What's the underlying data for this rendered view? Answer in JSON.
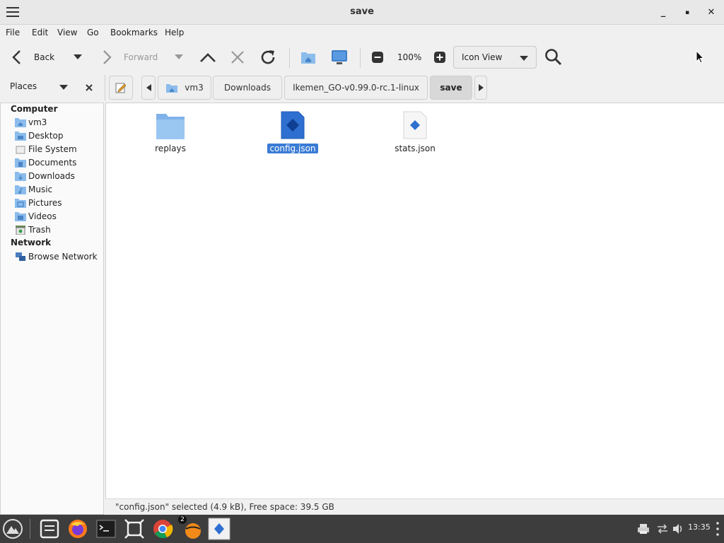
{
  "window": {
    "title": "save",
    "controls": {
      "minimize": "_",
      "maximize": "▪",
      "close": "✕"
    }
  },
  "menubar": [
    "File",
    "Edit",
    "View",
    "Go",
    "Bookmarks",
    "Help"
  ],
  "toolbar": {
    "back_label": "Back",
    "forward_label": "Forward",
    "zoom_level": "100%",
    "view_mode": "Icon View"
  },
  "locationbar": {
    "places_label": "Places",
    "breadcrumbs": [
      "vm3",
      "Downloads",
      "Ikemen_GO-v0.99.0-rc.1-linux",
      "save"
    ]
  },
  "sidebar": {
    "computer_heading": "Computer",
    "computer_items": [
      {
        "label": "vm3",
        "icon": "home-folder-icon"
      },
      {
        "label": "Desktop",
        "icon": "desktop-folder-icon"
      },
      {
        "label": "File System",
        "icon": "drive-icon"
      },
      {
        "label": "Documents",
        "icon": "documents-folder-icon"
      },
      {
        "label": "Downloads",
        "icon": "downloads-folder-icon"
      },
      {
        "label": "Music",
        "icon": "music-folder-icon"
      },
      {
        "label": "Pictures",
        "icon": "pictures-folder-icon"
      },
      {
        "label": "Videos",
        "icon": "videos-folder-icon"
      },
      {
        "label": "Trash",
        "icon": "trash-icon"
      }
    ],
    "network_heading": "Network",
    "network_items": [
      {
        "label": "Browse Network",
        "icon": "network-icon"
      }
    ]
  },
  "files": [
    {
      "name": "replays",
      "type": "folder",
      "selected": false
    },
    {
      "name": "config.json",
      "type": "json",
      "selected": true
    },
    {
      "name": "stats.json",
      "type": "json",
      "selected": false
    }
  ],
  "statusbar": {
    "text": "\"config.json\" selected (4.9 kB), Free space: 39.5 GB"
  },
  "taskbar": {
    "clock": "13:35",
    "badge_count": "2"
  },
  "colors": {
    "selection": "#3a7bd5",
    "folder": "#8bbcec",
    "taskbar": "#3d3d3d"
  }
}
